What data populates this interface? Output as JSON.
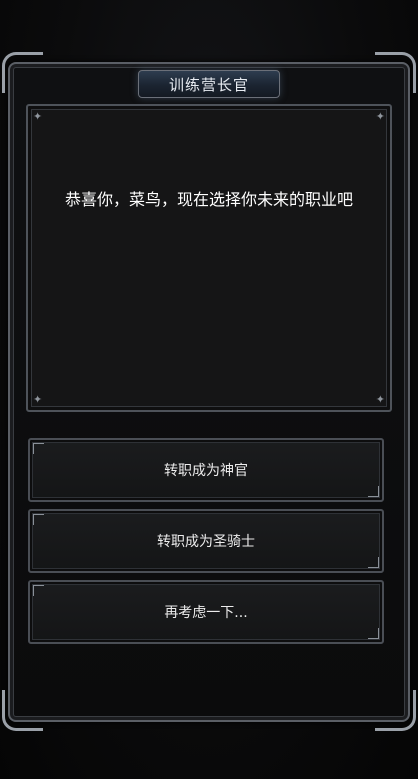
{
  "dialog": {
    "title": "训练营长官",
    "message": "恭喜你，菜鸟，现在选择你未来的职业吧"
  },
  "choices": [
    {
      "label": "转职成为神官"
    },
    {
      "label": "转职成为圣骑士"
    },
    {
      "label": "再考虑一下..."
    }
  ],
  "colors": {
    "background": "#0a0a0b",
    "frame": "#5b5f66",
    "title_banner": "#2e3d4f",
    "text": "#ffffff"
  }
}
